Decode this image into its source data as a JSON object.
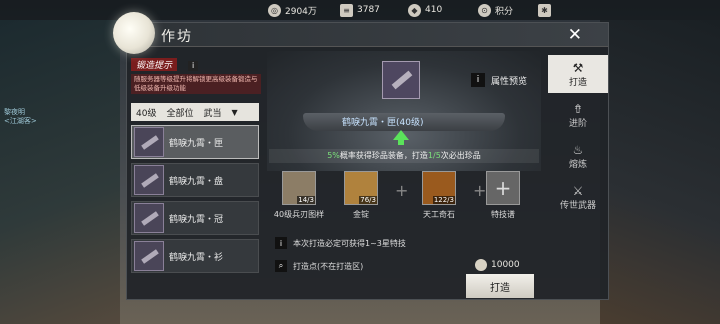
{
  "topbar": {
    "resources": [
      {
        "icon": "coin-stack-icon",
        "value": "2904万"
      },
      {
        "icon": "scroll-icon",
        "value": "3787"
      },
      {
        "icon": "ingot-icon",
        "value": "410"
      },
      {
        "icon": "points-icon",
        "value": "积分"
      }
    ]
  },
  "window": {
    "title": "作坊",
    "close_label": "✕"
  },
  "tip": {
    "title": "锻造提示",
    "info_label": "i",
    "text": "随服务器等级提升将解锁更高级装备锻造与低级装备升级功能"
  },
  "filters": {
    "level": "40级",
    "slot": "全部位",
    "sect": "武当"
  },
  "items": [
    {
      "label": "鹤唳九霄・匣"
    },
    {
      "label": "鹤唳九霄・盘"
    },
    {
      "label": "鹤唳九霄・冠"
    },
    {
      "label": "鹤唳九霄・衫"
    }
  ],
  "npc": {
    "name": "黎夜明",
    "sub": "<江湖客>"
  },
  "main": {
    "item_name": "鹤唳九霄・匣(40级)",
    "preview_label": "属性预览",
    "chance_text_pre": "5%",
    "chance_text_mid": "概率获得珍品装备，打造",
    "chance_hl2": "1/5",
    "chance_text_post": "次必出珍品"
  },
  "materials": [
    {
      "count": "14/3",
      "label": "40级兵刃图样"
    },
    {
      "count": "76/3",
      "label": "金锭"
    },
    {
      "count": "122/3",
      "label": "天工奇石"
    },
    {
      "count": "",
      "label": "特技谱"
    }
  ],
  "info": {
    "line1": "本次打造必定可获得1~3星特技",
    "line2": "打造点(不在打造区)",
    "cost": "10000",
    "forge_label": "打造"
  },
  "tabs": [
    {
      "label": "打造",
      "icon": "anvil-icon"
    },
    {
      "label": "进阶",
      "icon": "upgrade-icon"
    },
    {
      "label": "熔炼",
      "icon": "flame-icon"
    },
    {
      "label": "传世武器",
      "icon": "swords-icon"
    }
  ]
}
